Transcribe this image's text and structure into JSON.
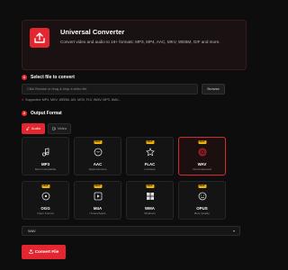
{
  "hero": {
    "title": "Universal Converter",
    "description": "Convert video and audio to 16+ formats: MP3, MP4, AAC, MKV, WEBM, GIF and more."
  },
  "step1": {
    "number": "1",
    "title": "Select file to convert",
    "placeholder": "Click Browse or drag & drop a video file",
    "browse_label": "Browse",
    "supported": "Supported: MP4, MKV, WEBM, AVI, MOV, FLV, WMV, MP3, WAV..."
  },
  "step2": {
    "number": "2",
    "title": "Output Format",
    "tabs": {
      "audio": "Audio",
      "video": "Video"
    }
  },
  "formats": [
    {
      "name": "MP3",
      "sub": "Most Compatible",
      "badge": "",
      "icon": "music-note"
    },
    {
      "name": "AAC",
      "sub": "Apple Devices",
      "badge": "NEW",
      "icon": "apple-circle"
    },
    {
      "name": "FLAC",
      "sub": "Lossless",
      "badge": "NEW",
      "icon": "star"
    },
    {
      "name": "WAV",
      "sub": "Uncompressed",
      "badge": "NEW",
      "icon": "waveform",
      "selected": true
    },
    {
      "name": "OGG",
      "sub": "Open Format",
      "badge": "NEW",
      "icon": "circle-dot"
    },
    {
      "name": "M4A",
      "sub": "iTunes/Apple",
      "badge": "NEW",
      "icon": "play-square"
    },
    {
      "name": "WMA",
      "sub": "Windows",
      "badge": "NEW",
      "icon": "windows"
    },
    {
      "name": "OPUS",
      "sub": "Best Quality",
      "badge": "NEW",
      "icon": "smiley"
    }
  ],
  "quality": {
    "selected": "WAV"
  },
  "convert": {
    "label": "Convert File"
  },
  "colors": {
    "accent": "#e3262f",
    "badge": "#f4b400",
    "background": "#0d0d0d"
  }
}
